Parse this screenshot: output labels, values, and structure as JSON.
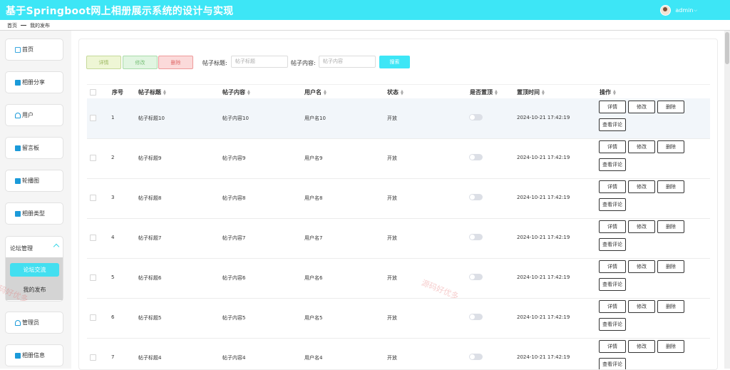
{
  "header": {
    "title": "基于Springboot网上相册展示系统的设计与实现",
    "user": "admin"
  },
  "breadcrumb": {
    "home": "首页",
    "current": "我的发布"
  },
  "sidebar": {
    "items": [
      {
        "label": "首页",
        "icon": "home-icon"
      },
      {
        "label": "相册分享",
        "icon": "album-icon"
      },
      {
        "label": "用户",
        "icon": "user-icon"
      },
      {
        "label": "留言板",
        "icon": "message-icon"
      },
      {
        "label": "轮播图",
        "icon": "carousel-icon"
      },
      {
        "label": "相册类型",
        "icon": "category-icon"
      }
    ],
    "forum": {
      "label": "论坛管理",
      "sub": [
        "论坛交流",
        "我的发布"
      ]
    },
    "bottom_items": [
      {
        "label": "管理员",
        "icon": "admin-icon"
      },
      {
        "label": "相册信息",
        "icon": "album-info-icon"
      }
    ]
  },
  "toolbar": {
    "detail": "详情",
    "edit": "修改",
    "delete": "删除",
    "title_label": "帖子标题:",
    "title_placeholder": "帖子标题",
    "content_label": "帖子内容:",
    "content_placeholder": "帖子内容",
    "search": "搜索"
  },
  "table": {
    "columns": [
      "序号",
      "帖子标题",
      "帖子内容",
      "用户名",
      "状态",
      "是否置顶",
      "置顶时间",
      "操作"
    ],
    "rows": [
      {
        "no": "1",
        "title": "帖子标题10",
        "content": "帖子内容10",
        "user": "用户名10",
        "status": "开放",
        "time": "2024-10-21 17:42:19"
      },
      {
        "no": "2",
        "title": "帖子标题9",
        "content": "帖子内容9",
        "user": "用户名9",
        "status": "开放",
        "time": "2024-10-21 17:42:19"
      },
      {
        "no": "3",
        "title": "帖子标题8",
        "content": "帖子内容8",
        "user": "用户名8",
        "status": "开放",
        "time": "2024-10-21 17:42:19"
      },
      {
        "no": "4",
        "title": "帖子标题7",
        "content": "帖子内容7",
        "user": "用户名7",
        "status": "开放",
        "time": "2024-10-21 17:42:19"
      },
      {
        "no": "5",
        "title": "帖子标题6",
        "content": "帖子内容6",
        "user": "用户名6",
        "status": "开放",
        "time": "2024-10-21 17:42:19"
      },
      {
        "no": "6",
        "title": "帖子标题5",
        "content": "帖子内容5",
        "user": "用户名5",
        "status": "开放",
        "time": "2024-10-21 17:42:19"
      },
      {
        "no": "7",
        "title": "帖子标题4",
        "content": "帖子内容4",
        "user": "用户名4",
        "status": "开放",
        "time": "2024-10-21 17:42:19"
      }
    ],
    "actions": {
      "detail": "详情",
      "edit": "修改",
      "delete": "删除",
      "comments": "查看评论"
    }
  },
  "watermark": "源码好优多",
  "colors": {
    "topbar": "#3de6f6",
    "accent": "#43dff0"
  }
}
